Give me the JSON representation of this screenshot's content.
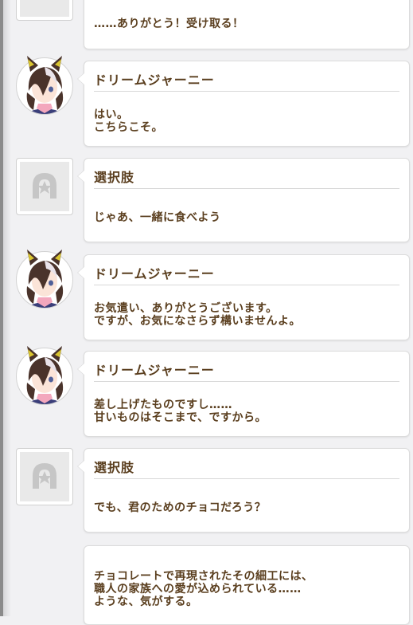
{
  "entries": [
    {
      "type": "partial",
      "speaker": "",
      "text": "……ありがとう！受け取る！"
    },
    {
      "type": "character",
      "speaker": "ドリームジャーニー",
      "text": "はい。\nこちらこそ。"
    },
    {
      "type": "choice",
      "speaker": "選択肢",
      "text": "じゃあ、一緒に食べよう"
    },
    {
      "type": "character",
      "speaker": "ドリームジャーニー",
      "text": "お気遣い、ありがとうございます。\nですが、お気になさらず構いませんよ。"
    },
    {
      "type": "character",
      "speaker": "ドリームジャーニー",
      "text": "差し上げたものですし……\n甘いものはそこまで、ですから。"
    },
    {
      "type": "choice",
      "speaker": "選択肢",
      "text": "でも、君のためのチョコだろう？"
    },
    {
      "type": "narration",
      "speaker": "",
      "text": "チョコレートで再現されたその細工には、\n職人の家族への愛が込められている……\nような、気がする。"
    }
  ],
  "colors": {
    "text": "#5a3e1e",
    "bubble": "#ffffff",
    "background": "#f1f1f3"
  },
  "icons": {
    "character": "dream-journey-portrait",
    "choice": "choice-horseshoe-icon"
  }
}
